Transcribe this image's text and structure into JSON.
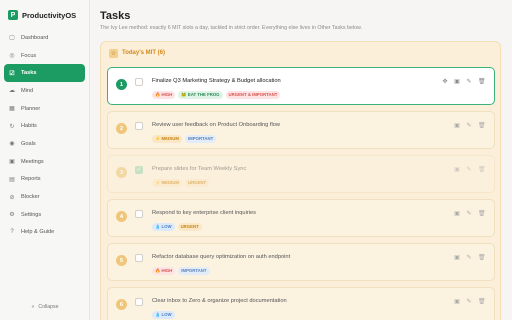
{
  "brand": {
    "name": "ProductivityOS",
    "logo_letter": "P"
  },
  "sidebar": {
    "items": [
      {
        "label": "Dashboard",
        "icon": "dashboard-icon",
        "glyph": "▢",
        "active": false
      },
      {
        "label": "Focus",
        "icon": "focus-icon",
        "glyph": "◎",
        "active": false
      },
      {
        "label": "Tasks",
        "icon": "tasks-icon",
        "glyph": "☑",
        "active": true
      },
      {
        "label": "Mind",
        "icon": "mind-icon",
        "glyph": "☁",
        "active": false
      },
      {
        "label": "Planner",
        "icon": "planner-icon",
        "glyph": "▦",
        "active": false
      },
      {
        "label": "Habits",
        "icon": "habits-icon",
        "glyph": "↻",
        "active": false
      },
      {
        "label": "Goals",
        "icon": "goals-icon",
        "glyph": "◉",
        "active": false
      },
      {
        "label": "Meetings",
        "icon": "meetings-icon",
        "glyph": "▣",
        "active": false
      },
      {
        "label": "Reports",
        "icon": "reports-icon",
        "glyph": "▤",
        "active": false
      },
      {
        "label": "Blocker",
        "icon": "blocker-icon",
        "glyph": "⊘",
        "active": false
      },
      {
        "label": "Settings",
        "icon": "settings-icon",
        "glyph": "⚙",
        "active": false
      },
      {
        "label": "Help & Guide",
        "icon": "help-icon",
        "glyph": "?",
        "active": false
      }
    ],
    "collapse_label": "Collapse"
  },
  "header": {
    "title": "Tasks",
    "subtitle": "The Ivy Lee method: exactly 6 MIT slots a day, tackled in strict order. Everything else lives in Other Tasks below."
  },
  "mit": {
    "label": "Today's MIT (6)",
    "tasks": [
      {
        "num": "1",
        "title": "Finalize Q3 Marketing Strategy & Budget allocation",
        "state": "focused",
        "checked": false,
        "tags": [
          {
            "text": "🔥 HIGH",
            "kind": "high"
          },
          {
            "text": "🐸 EAT THE FROG",
            "kind": "frog"
          },
          {
            "text": "URGENT & IMPORTANT",
            "kind": "urgimp"
          }
        ]
      },
      {
        "num": "2",
        "title": "Review user feedback on Product Onboarding flow",
        "state": "normal",
        "checked": false,
        "tags": [
          {
            "text": "⚡ MEDIUM",
            "kind": "medium"
          },
          {
            "text": "IMPORTANT",
            "kind": "imp"
          }
        ]
      },
      {
        "num": "3",
        "title": "Prepare slides for Team Weekly Sync",
        "state": "done",
        "checked": true,
        "tags": [
          {
            "text": "⚡ MEDIUM",
            "kind": "medium"
          },
          {
            "text": "URGENT",
            "kind": "urg"
          }
        ]
      },
      {
        "num": "4",
        "title": "Respond to key enterprise client inquiries",
        "state": "normal",
        "checked": false,
        "tags": [
          {
            "text": "💧 LOW",
            "kind": "low"
          },
          {
            "text": "URGENT",
            "kind": "urg"
          }
        ]
      },
      {
        "num": "5",
        "title": "Refactor database query optimization on auth endpoint",
        "state": "normal",
        "checked": false,
        "tags": [
          {
            "text": "🔥 HIGH",
            "kind": "high"
          },
          {
            "text": "IMPORTANT",
            "kind": "imp"
          }
        ]
      },
      {
        "num": "6",
        "title": "Clear inbox to Zero & organize project documentation",
        "state": "normal",
        "checked": false,
        "tags": [
          {
            "text": "💧 LOW",
            "kind": "low"
          }
        ]
      }
    ]
  },
  "task_actions": [
    {
      "name": "drag-handle-icon",
      "glyph": "✥"
    },
    {
      "name": "calendar-icon",
      "glyph": "▣"
    },
    {
      "name": "edit-icon",
      "glyph": "✎"
    },
    {
      "name": "delete-icon",
      "glyph": "🗑"
    }
  ]
}
